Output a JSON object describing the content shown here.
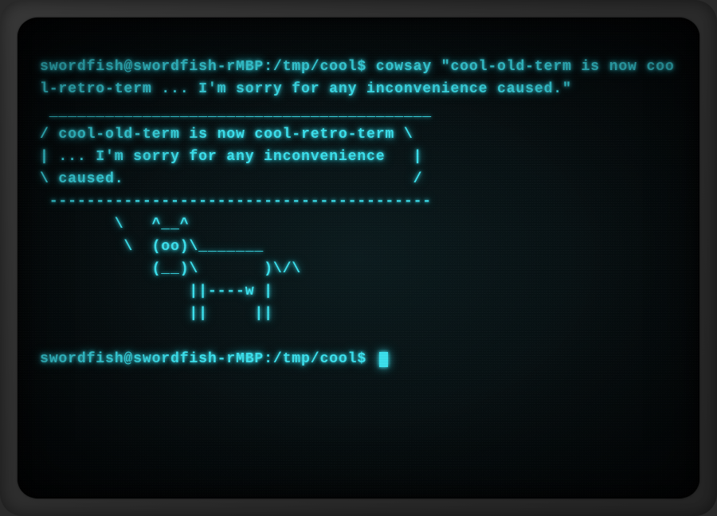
{
  "colors": {
    "phosphor": "#3be3f0",
    "screen_bg": "#050d0f",
    "frame": "#2c2c2c"
  },
  "terminal": {
    "prompt1_user_host": "swordfish@swordfish-rMBP",
    "prompt1_path": "/tmp/cool",
    "prompt1_symbol": "$",
    "command1": "cowsay \"cool-old-term is now cool-retro-term ... I'm sorry for any inconvenience caused.\"",
    "cowsay_output": " _________________________________________\n/ cool-old-term is now cool-retro-term \\\n| ... I'm sorry for any inconvenience   |\n\\ caused.                               /\n -----------------------------------------\n        \\   ^__^\n         \\  (oo)\\_______\n            (__)\\       )\\/\\\n                ||----w |\n                ||     ||",
    "prompt2_user_host": "swordfish@swordfish-rMBP",
    "prompt2_path": "/tmp/cool",
    "prompt2_symbol": "$"
  }
}
